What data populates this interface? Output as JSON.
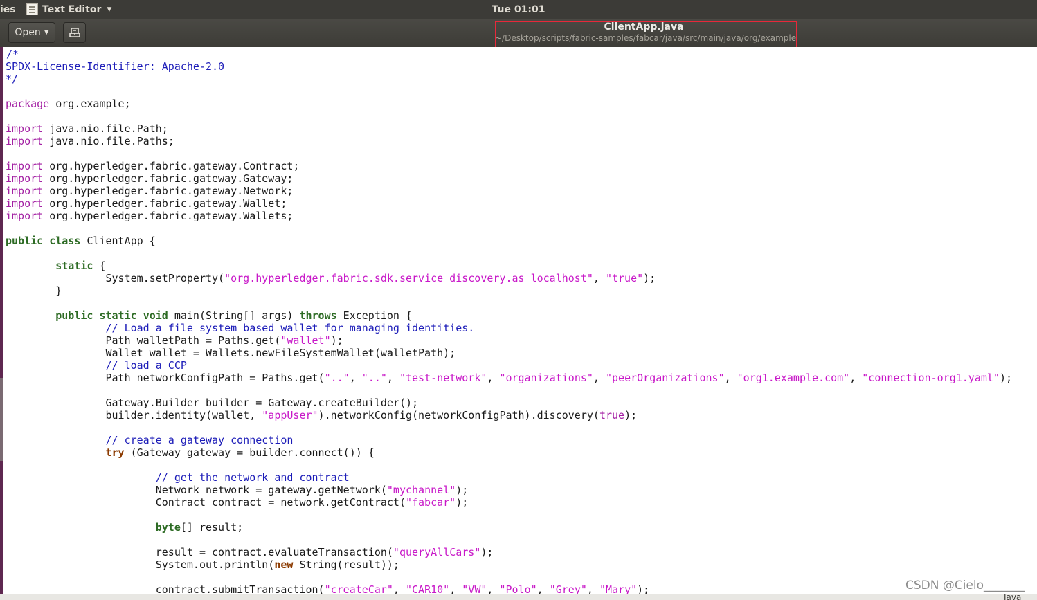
{
  "top_panel": {
    "activities": "ies",
    "app_name": "Text Editor",
    "app_icon": "text-editor-icon",
    "clock": "Tue 01:01"
  },
  "header": {
    "open_label": "Open",
    "save_icon": "save-document-icon",
    "file_name": "ClientApp.java",
    "file_path": "~/Desktop/scripts/fabric-samples/fabcar/java/src/main/java/org/example"
  },
  "editor": {
    "lines": [
      [
        {
          "t": "/*",
          "c": "c"
        }
      ],
      [
        {
          "t": "SPDX-License-Identifier: Apache-2.0",
          "c": "c"
        }
      ],
      [
        {
          "t": "*/",
          "c": "c"
        }
      ],
      [],
      [
        {
          "t": "package",
          "c": "k"
        },
        {
          "t": " org.example;"
        }
      ],
      [],
      [
        {
          "t": "import",
          "c": "k"
        },
        {
          "t": " java.nio.file.Path;"
        }
      ],
      [
        {
          "t": "import",
          "c": "k"
        },
        {
          "t": " java.nio.file.Paths;"
        }
      ],
      [],
      [
        {
          "t": "import",
          "c": "k"
        },
        {
          "t": " org.hyperledger.fabric.gateway.Contract;"
        }
      ],
      [
        {
          "t": "import",
          "c": "k"
        },
        {
          "t": " org.hyperledger.fabric.gateway.Gateway;"
        }
      ],
      [
        {
          "t": "import",
          "c": "k"
        },
        {
          "t": " org.hyperledger.fabric.gateway.Network;"
        }
      ],
      [
        {
          "t": "import",
          "c": "k"
        },
        {
          "t": " org.hyperledger.fabric.gateway.Wallet;"
        }
      ],
      [
        {
          "t": "import",
          "c": "k"
        },
        {
          "t": " org.hyperledger.fabric.gateway.Wallets;"
        }
      ],
      [],
      [
        {
          "t": "public",
          "c": "kb"
        },
        {
          "t": " "
        },
        {
          "t": "class",
          "c": "kb"
        },
        {
          "t": " ClientApp {"
        }
      ],
      [],
      [
        {
          "t": "        "
        },
        {
          "t": "static",
          "c": "kb"
        },
        {
          "t": " {"
        }
      ],
      [
        {
          "t": "                System.setProperty("
        },
        {
          "t": "\"org.hyperledger.fabric.sdk.service_discovery.as_localhost\"",
          "c": "s"
        },
        {
          "t": ", "
        },
        {
          "t": "\"true\"",
          "c": "s"
        },
        {
          "t": ");"
        }
      ],
      [
        {
          "t": "        }"
        }
      ],
      [],
      [
        {
          "t": "        "
        },
        {
          "t": "public",
          "c": "kb"
        },
        {
          "t": " "
        },
        {
          "t": "static",
          "c": "kb"
        },
        {
          "t": " "
        },
        {
          "t": "void",
          "c": "kb"
        },
        {
          "t": " main(String[] args) "
        },
        {
          "t": "throws",
          "c": "kb"
        },
        {
          "t": " Exception {"
        }
      ],
      [
        {
          "t": "                "
        },
        {
          "t": "// Load a file system based wallet for managing identities.",
          "c": "c"
        }
      ],
      [
        {
          "t": "                Path walletPath = Paths.get("
        },
        {
          "t": "\"wallet\"",
          "c": "s"
        },
        {
          "t": ");"
        }
      ],
      [
        {
          "t": "                Wallet wallet = Wallets.newFileSystemWallet(walletPath);"
        }
      ],
      [
        {
          "t": "                "
        },
        {
          "t": "// load a CCP",
          "c": "c"
        }
      ],
      [
        {
          "t": "                Path networkConfigPath = Paths.get("
        },
        {
          "t": "\"..\"",
          "c": "s"
        },
        {
          "t": ", "
        },
        {
          "t": "\"..\"",
          "c": "s"
        },
        {
          "t": ", "
        },
        {
          "t": "\"test-network\"",
          "c": "s"
        },
        {
          "t": ", "
        },
        {
          "t": "\"organizations\"",
          "c": "s"
        },
        {
          "t": ", "
        },
        {
          "t": "\"peerOrganizations\"",
          "c": "s"
        },
        {
          "t": ", "
        },
        {
          "t": "\"org1.example.com\"",
          "c": "s"
        },
        {
          "t": ", "
        },
        {
          "t": "\"connection-org1.yaml\"",
          "c": "s"
        },
        {
          "t": ");"
        }
      ],
      [],
      [
        {
          "t": "                Gateway.Builder builder = Gateway.createBuilder();"
        }
      ],
      [
        {
          "t": "                builder.identity(wallet, "
        },
        {
          "t": "\"appUser\"",
          "c": "s"
        },
        {
          "t": ").networkConfig(networkConfigPath).discovery("
        },
        {
          "t": "true",
          "c": "k"
        },
        {
          "t": ");"
        }
      ],
      [],
      [
        {
          "t": "                "
        },
        {
          "t": "// create a gateway connection",
          "c": "c"
        }
      ],
      [
        {
          "t": "                "
        },
        {
          "t": "try",
          "c": "kr"
        },
        {
          "t": " (Gateway gateway = builder.connect()) {"
        }
      ],
      [],
      [
        {
          "t": "                        "
        },
        {
          "t": "// get the network and contract",
          "c": "c"
        }
      ],
      [
        {
          "t": "                        Network network = gateway.getNetwork("
        },
        {
          "t": "\"mychannel\"",
          "c": "s"
        },
        {
          "t": ");"
        }
      ],
      [
        {
          "t": "                        Contract contract = network.getContract("
        },
        {
          "t": "\"fabcar\"",
          "c": "s"
        },
        {
          "t": ");"
        }
      ],
      [],
      [
        {
          "t": "                        "
        },
        {
          "t": "byte",
          "c": "kb"
        },
        {
          "t": "[] result;"
        }
      ],
      [],
      [
        {
          "t": "                        result = contract.evaluateTransaction("
        },
        {
          "t": "\"queryAllCars\"",
          "c": "s"
        },
        {
          "t": ");"
        }
      ],
      [
        {
          "t": "                        System.out.println("
        },
        {
          "t": "new",
          "c": "kr"
        },
        {
          "t": " String(result));"
        }
      ],
      [],
      [
        {
          "t": "                        contract.submitTransaction("
        },
        {
          "t": "\"createCar\"",
          "c": "s"
        },
        {
          "t": ", "
        },
        {
          "t": "\"CAR10\"",
          "c": "s"
        },
        {
          "t": ", "
        },
        {
          "t": "\"VW\"",
          "c": "s"
        },
        {
          "t": ", "
        },
        {
          "t": "\"Polo\"",
          "c": "s"
        },
        {
          "t": ", "
        },
        {
          "t": "\"Grey\"",
          "c": "s"
        },
        {
          "t": ", "
        },
        {
          "t": "\"Mary\"",
          "c": "s"
        },
        {
          "t": ");"
        }
      ]
    ]
  },
  "status_bar": {
    "language": "Java"
  },
  "watermark": "CSDN @Cielo_______",
  "colors": {
    "keyword": "#a31fa3",
    "type_keyword": "#2d6b24",
    "control_keyword": "#8b3a00",
    "comment": "#1c1cb8",
    "string": "#c818c8",
    "highlight_box": "#e8283a"
  }
}
